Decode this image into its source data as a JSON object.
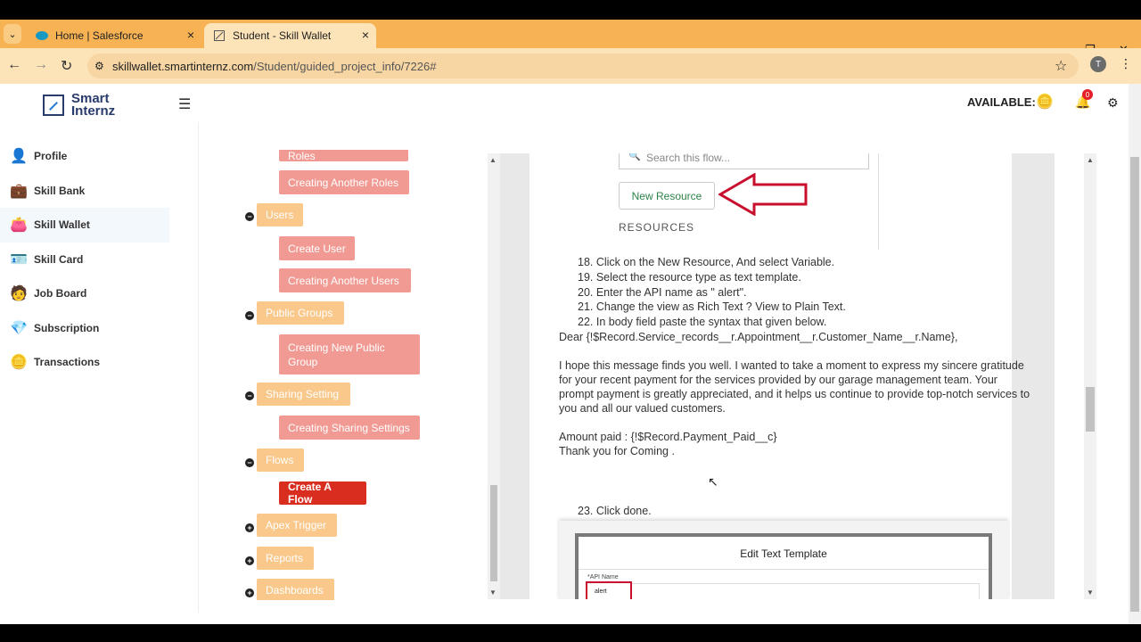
{
  "browser": {
    "tabs": [
      {
        "title": "Home | Salesforce",
        "icon": "salesforce-icon"
      },
      {
        "title": "Student - Skill Wallet",
        "icon": "page-icon"
      }
    ],
    "url_domain": "skillwallet.smartinternz.com",
    "url_path": "/Student/guided_project_info/7226#",
    "profile_initial": "T"
  },
  "header": {
    "logo_line1": "Smart",
    "logo_line2": "Internz",
    "available_label": "AVAILABLE: 0",
    "notification_count": "0"
  },
  "sidebar": {
    "items": [
      {
        "label": "Profile",
        "icon": "person-icon"
      },
      {
        "label": "Skill Bank",
        "icon": "briefcase-icon"
      },
      {
        "label": "Skill Wallet",
        "icon": "wallet-icon"
      },
      {
        "label": "Skill Card",
        "icon": "card-icon"
      },
      {
        "label": "Job Board",
        "icon": "job-icon"
      },
      {
        "label": "Subscription",
        "icon": "diamond-icon"
      },
      {
        "label": "Transactions",
        "icon": "coins-icon"
      }
    ]
  },
  "tree": {
    "partial_top": "Creating Manager Roles",
    "creating_another_roles": "Creating Another Roles",
    "users": "Users",
    "create_user": "Create User",
    "creating_another_users": "Creating Another Users",
    "public_groups": "Public Groups",
    "creating_new_public_group": "Creating New Public Group",
    "sharing_setting": "Sharing Setting",
    "creating_sharing_settings": "Creating Sharing Settings",
    "flows": "Flows",
    "create_a_flow": "Create A Flow",
    "apex_trigger": "Apex Trigger",
    "reports": "Reports",
    "dashboards": "Dashboards"
  },
  "content": {
    "search_placeholder": "Search this flow...",
    "new_resource": "New Resource",
    "resources_label": "RESOURCES",
    "steps": [
      "18. Click on the New Resource, And select Variable.",
      "19. Select the resource type as text template.",
      "20. Enter the API name as \" alert\".",
      "21. Change the view as Rich Text ? View to Plain Text.",
      "22. In body field  paste the syntax that given below."
    ],
    "greeting": "Dear {!$Record.Service_records__r.Appointment__r.Customer_Name__r.Name},",
    "paragraph": "I hope this message finds you well. I wanted to take a moment to express my sincere gratitude for your recent payment for the services provided by our garage management team. Your prompt payment is greatly appreciated, and it helps us continue to provide top-notch services to you and all our valued customers.",
    "amount_line": "Amount paid : {!$Record.Payment_Paid__c}",
    "thanks_line": "Thank you for Coming .",
    "step23": "23. Click done.",
    "dialog_title": "Edit Text Template",
    "api_name_label": "*API Name",
    "api_value": "alert"
  },
  "colors": {
    "tab_bar": "#f7b253",
    "node_parent": "#f9c88a",
    "node_child": "#f19a93",
    "node_active": "#d92e1f",
    "arrow": "#c8102e"
  }
}
